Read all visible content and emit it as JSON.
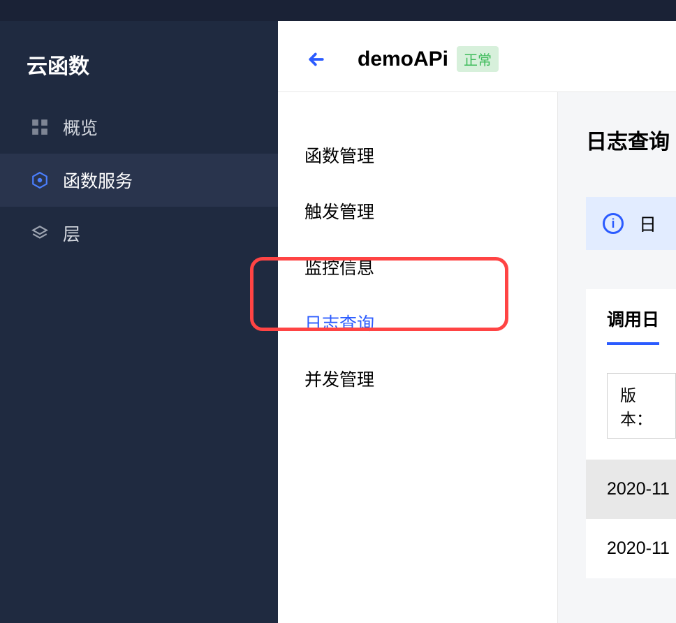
{
  "sidebar": {
    "title": "云函数",
    "items": [
      {
        "label": "概览",
        "icon": "grid"
      },
      {
        "label": "函数服务",
        "icon": "hexagon"
      },
      {
        "label": "层",
        "icon": "layers"
      }
    ]
  },
  "header": {
    "title": "demoAPi",
    "status": "正常"
  },
  "subnav": {
    "items": [
      {
        "label": "函数管理"
      },
      {
        "label": "触发管理"
      },
      {
        "label": "监控信息"
      },
      {
        "label": "日志查询"
      },
      {
        "label": "并发管理"
      }
    ]
  },
  "panel": {
    "title": "日志查询",
    "info_text": "日",
    "tab_label": "调用日",
    "version_label": "版本：",
    "dates": [
      "2020-11",
      "2020-11"
    ]
  }
}
